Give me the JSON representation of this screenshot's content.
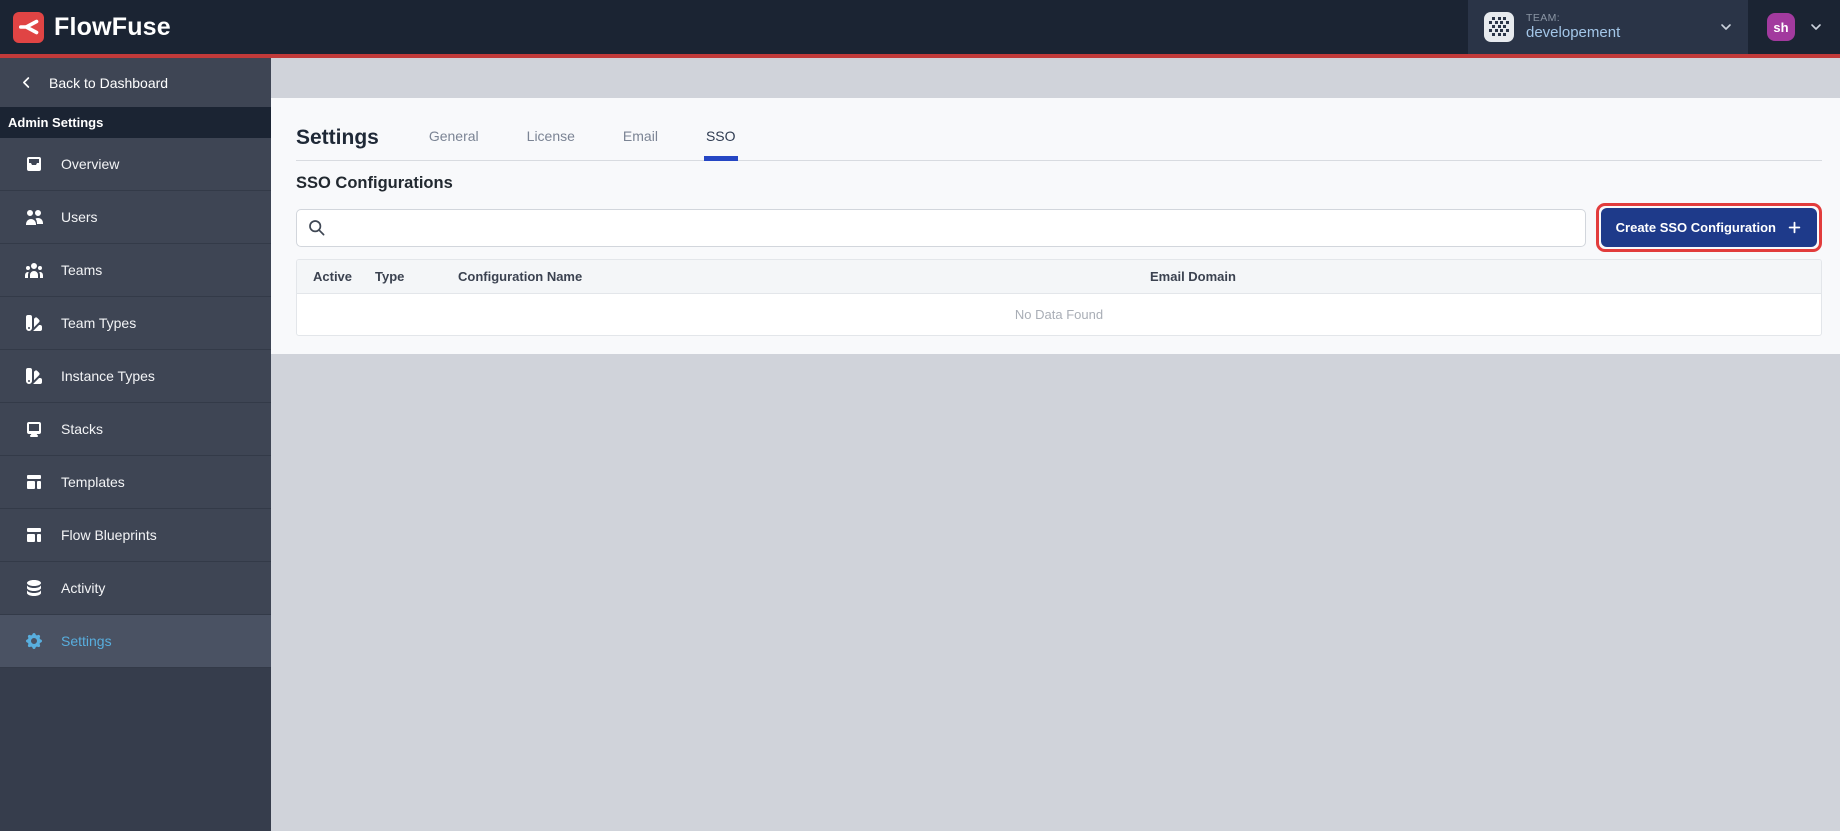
{
  "navbar": {
    "brand": "FlowFuse",
    "team_label": "TEAM:",
    "team_name": "developement",
    "user_initials": "sh"
  },
  "sidebar": {
    "back_label": "Back to Dashboard",
    "section_label": "Admin Settings",
    "items": [
      {
        "label": "Overview",
        "icon": "inbox-icon",
        "active": false
      },
      {
        "label": "Users",
        "icon": "users-icon",
        "active": false
      },
      {
        "label": "Teams",
        "icon": "user-group-icon",
        "active": false
      },
      {
        "label": "Team Types",
        "icon": "color-swatch-icon",
        "active": false
      },
      {
        "label": "Instance Types",
        "icon": "color-swatch-icon",
        "active": false
      },
      {
        "label": "Stacks",
        "icon": "desktop-icon",
        "active": false
      },
      {
        "label": "Templates",
        "icon": "template-icon",
        "active": false
      },
      {
        "label": "Flow Blueprints",
        "icon": "template-icon",
        "active": false
      },
      {
        "label": "Activity",
        "icon": "database-icon",
        "active": false
      },
      {
        "label": "Settings",
        "icon": "cog-icon",
        "active": true
      }
    ]
  },
  "main": {
    "title": "Settings",
    "tabs": [
      {
        "label": "General",
        "active": false
      },
      {
        "label": "License",
        "active": false
      },
      {
        "label": "Email",
        "active": false
      },
      {
        "label": "SSO",
        "active": true
      }
    ],
    "section_title": "SSO Configurations",
    "search": {
      "value": "",
      "placeholder": ""
    },
    "create_button": {
      "label": "Create SSO Configuration",
      "icon": "plus-icon"
    },
    "table": {
      "headers": [
        "Active",
        "Type",
        "Configuration Name",
        "Email Domain"
      ],
      "rows": [],
      "empty_message": "No Data Found"
    }
  },
  "annotations": {
    "highlight_box": {
      "target": "create-sso-configuration-button",
      "color": "#e23c3c"
    }
  },
  "colors": {
    "navbar_bg": "#1b2433",
    "navbar_accent_line": "#c23a3a",
    "brand_red": "#e04444",
    "sidebar_bg": "#363d4c",
    "sidebar_active_text": "#58aede",
    "tab_active_underline": "#2546c4",
    "primary_button_bg": "#1e3a8a",
    "avatar_bg": "#a23a9e",
    "team_name_text": "#a3c6e8"
  }
}
